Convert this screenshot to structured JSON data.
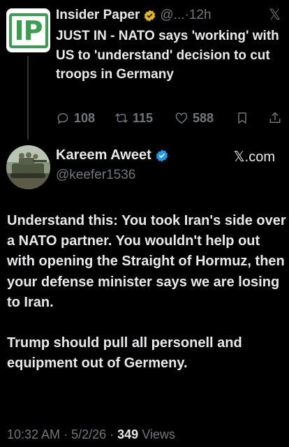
{
  "parent_tweet": {
    "avatar_text": "IP",
    "author_name": "Insider Paper",
    "handle": "@...",
    "separator": "·",
    "time": "12h",
    "text": "JUST IN - NATO says 'working' with US to 'understand' decision to cut troops in Germany",
    "reply_count": "108",
    "retweet_count": "115",
    "like_count": "588"
  },
  "main_tweet": {
    "author_name": "Kareem Aweet",
    "handle": "@keefer1536",
    "source": "𝕏.com",
    "paragraph_1": "Understand this: You took Iran's side over a NATO partner. You wouldn't help out with opening the Straight of Hormuz, then your defense minister says we are losing to Iran.",
    "paragraph_2": "Trump should pull all personell and equipment out of Germeny.",
    "time": "10:32 AM",
    "date": "5/2/26",
    "views_count": "349",
    "views_label": "Views"
  },
  "colors": {
    "background": "#000000",
    "text_primary": "#e7e9ea",
    "text_secondary": "#71767b",
    "verified_blue": "#1d9bf0",
    "verified_gold": "#e2b719",
    "ip_green": "#3a9d4f"
  },
  "icons": [
    "x-logo-icon",
    "reply-icon",
    "retweet-icon",
    "like-icon",
    "bookmark-icon",
    "share-icon",
    "verified-badge-icon",
    "gold-badge-icon"
  ]
}
